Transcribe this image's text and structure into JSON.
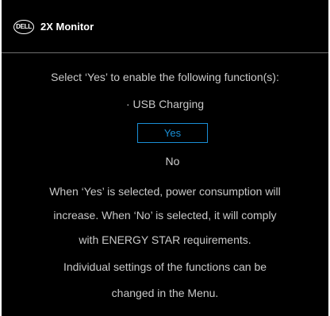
{
  "header": {
    "logo_text": "DELL",
    "title": "2X Monitor"
  },
  "dialog": {
    "prompt": "Select ‘Yes’ to enable the following function(s):",
    "function_item": "· USB Charging",
    "options": {
      "yes_label": "Yes",
      "no_label": "No",
      "selected": "Yes"
    },
    "info_lines": [
      "When ‘Yes’ is selected, power consumption will",
      "increase. When ‘No’ is selected, it will comply",
      "with ENERGY STAR requirements.",
      "Individual settings of the functions can be",
      "changed in the Menu."
    ]
  },
  "colors": {
    "background": "#000000",
    "text": "#c9c9c9",
    "accent": "#1a8fd6",
    "divider": "#6e6e6e"
  }
}
